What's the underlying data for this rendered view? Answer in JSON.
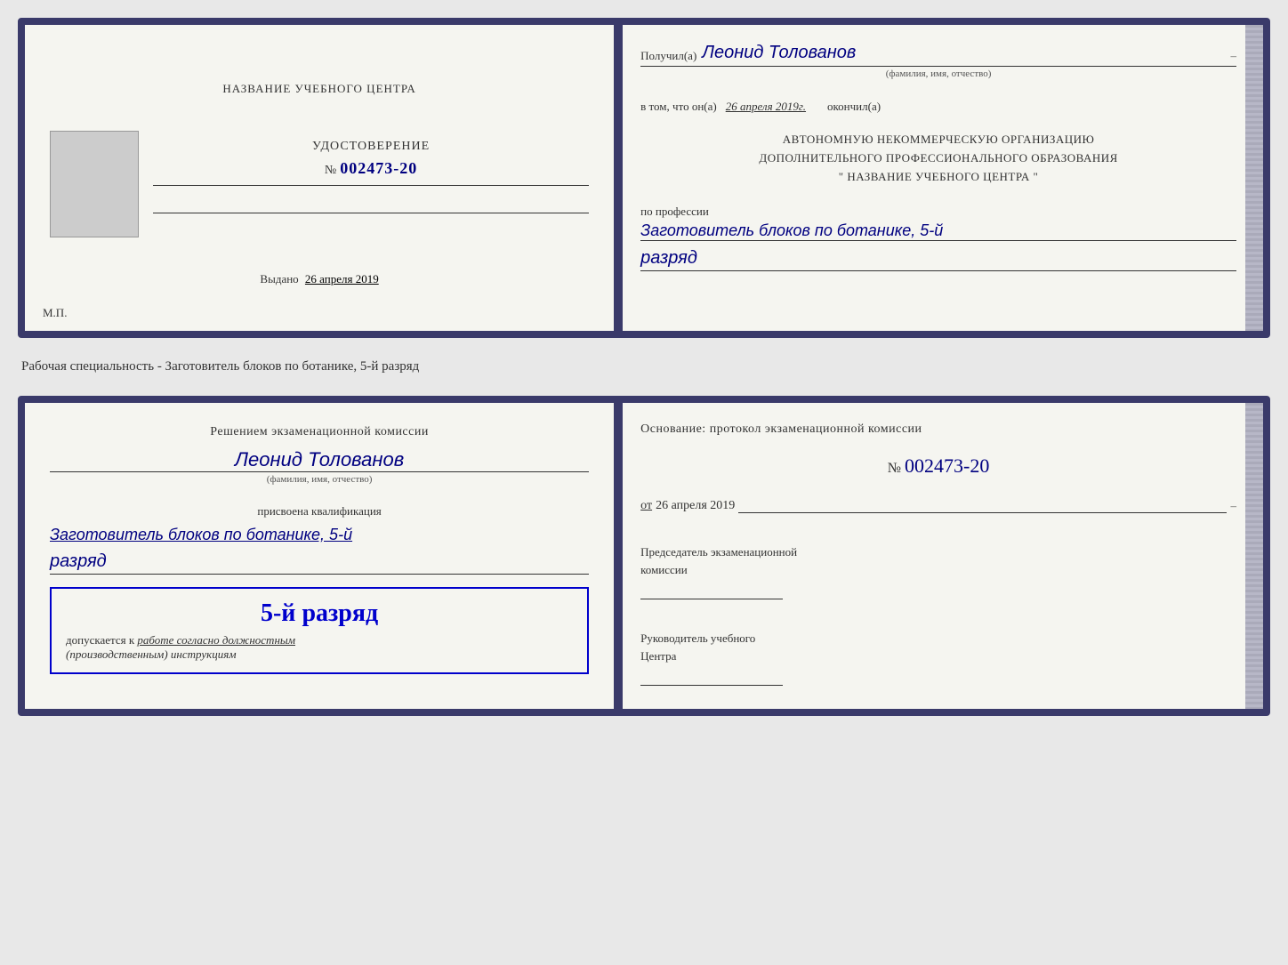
{
  "top_doc": {
    "left": {
      "school_name": "НАЗВАНИЕ УЧЕБНОГО ЦЕНТРА",
      "cert_title": "УДОСТОВЕРЕНИЕ",
      "cert_number_prefix": "№",
      "cert_number": "002473-20",
      "issued_label": "Выдано",
      "issued_date": "26 апреля 2019",
      "mp_label": "М.П."
    },
    "right": {
      "recipient_label": "Получил(а)",
      "recipient_name": "Леонид Толованов",
      "fio_hint": "(фамилия, имя, отчество)",
      "certifies_text": "в том, что он(а)",
      "certifies_date": "26 апреля 2019г.",
      "finished_label": "окончил(а)",
      "org_line1": "АВТОНОМНУЮ НЕКОММЕРЧЕСКУЮ ОРГАНИЗАЦИЮ",
      "org_line2": "ДОПОЛНИТЕЛЬНОГО ПРОФЕССИОНАЛЬНОГО ОБРАЗОВАНИЯ",
      "org_line3": "\" НАЗВАНИЕ УЧЕБНОГО ЦЕНТРА \"",
      "profession_label": "по профессии",
      "profession_value": "Заготовитель блоков по ботанике, 5-й",
      "razryad_value": "разряд"
    }
  },
  "specialty_label": "Рабочая специальность - Заготовитель блоков по ботанике, 5-й разряд",
  "bottom_doc": {
    "left": {
      "commission_decision_line1": "Решением экзаменационной комиссии",
      "person_name": "Леонид Толованов",
      "fio_hint": "(фамилия, имя, отчество)",
      "qualification_assigned": "присвоена квалификация",
      "qualification_value": "Заготовитель блоков по ботанике, 5-й",
      "razryad_value": "разряд",
      "stamp_rank": "5-й разряд",
      "stamp_allowed_prefix": "допускается к",
      "stamp_allowed_value": "работе согласно должностным",
      "stamp_allowed_cont": "(производственным) инструкциям"
    },
    "right": {
      "basis_label": "Основание: протокол экзаменационной комиссии",
      "number_prefix": "№",
      "basis_number": "002473-20",
      "date_prefix": "от",
      "basis_date": "26 апреля 2019",
      "chairman_label": "Председатель экзаменационной",
      "chairman_label2": "комиссии",
      "director_label": "Руководитель учебного",
      "director_label2": "Центра"
    }
  }
}
